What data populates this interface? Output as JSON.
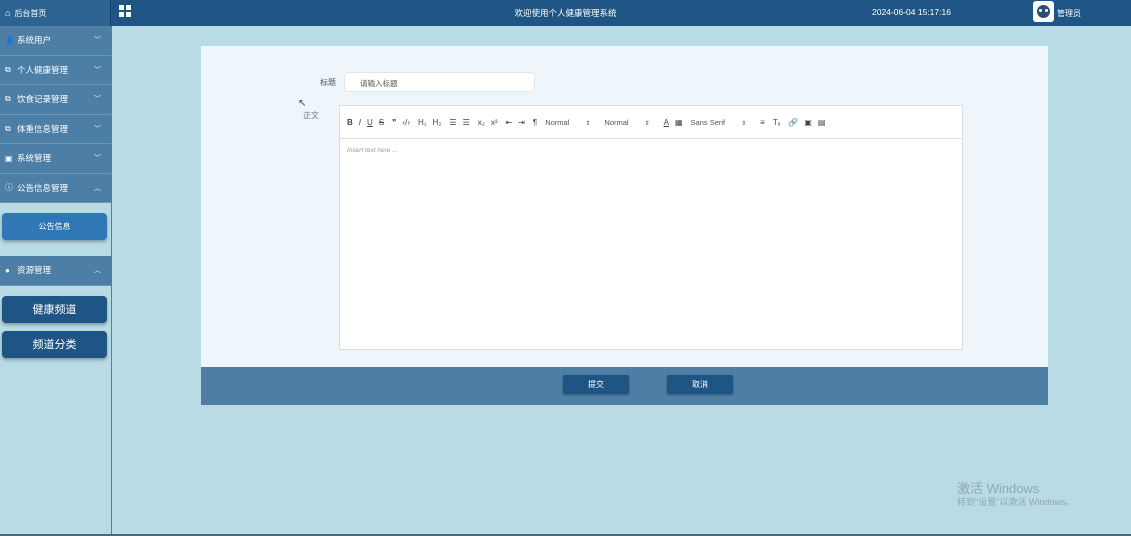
{
  "topbar": {
    "home_label": "后台首页",
    "welcome": "欢迎使用个人健康管理系统",
    "datetime": "2024-06-04 15:17:16",
    "user": "管理员"
  },
  "sidebar": {
    "items": [
      {
        "label": "系统用户",
        "icon": "user-icon",
        "chevron": "down"
      },
      {
        "label": "个人健康管理",
        "icon": "external-link-icon",
        "chevron": "down"
      },
      {
        "label": "饮食记录管理",
        "icon": "external-link-icon",
        "chevron": "down"
      },
      {
        "label": "体重信息管理",
        "icon": "external-link-icon",
        "chevron": "down"
      },
      {
        "label": "系统管理",
        "icon": "image-icon",
        "chevron": "down"
      },
      {
        "label": "公告信息管理",
        "icon": "info-circle-icon",
        "chevron": "up"
      }
    ],
    "announcement_sub": "公告信息",
    "resource_label": "资源管理",
    "resource_sub": [
      "健康频道",
      "频道分类"
    ]
  },
  "form": {
    "title_label": "标题",
    "title_placeholder": "请输入标题",
    "body_label": "正文",
    "editor_placeholder": "Insert text here ...",
    "toolbar": {
      "header_select": "Normal",
      "size_select": "Normal",
      "font_select": "Sans Serif"
    }
  },
  "actions": {
    "submit": "提交",
    "cancel": "取消"
  },
  "watermark": {
    "line1": "激活 Windows",
    "line2": "转到\"设置\"以激活 Windows。"
  },
  "colors": {
    "topbar": "#1f5584",
    "sidebar_item": "#4d7ea5",
    "background": "#b9dbe5",
    "button": "#1f5584"
  }
}
